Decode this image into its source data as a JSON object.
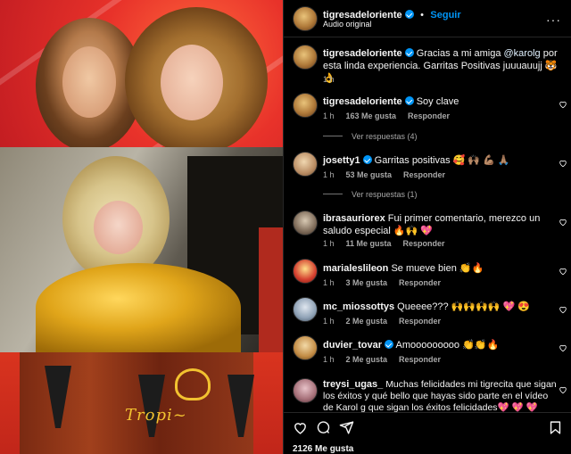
{
  "post": {
    "author": "tigresadeloriente",
    "follow_label": "Seguir",
    "separator": "•",
    "audio_label": "Audio original",
    "more": "···"
  },
  "caption": {
    "username": "tigresadeloriente",
    "text_before": "Gracias a mi amiga ",
    "mention": "@karolg",
    "text_after": " por esta linda experiencia. Garritas Positivas juuuauujj 🐯👌",
    "time": "1 h"
  },
  "comments": [
    {
      "username": "tigresadeloriente",
      "verified": true,
      "text": "Soy clave",
      "time": "1 h",
      "likes": "163 Me gusta",
      "reply": "Responder",
      "view_replies": "Ver respuestas (4)"
    },
    {
      "username": "josetty1",
      "verified": true,
      "text": "Garritas positivas 🥰 🙌🏽 💪🏽 🙏🏽",
      "time": "1 h",
      "likes": "53 Me gusta",
      "reply": "Responder",
      "view_replies": "Ver respuestas (1)"
    },
    {
      "username": "ibrasauriorex",
      "verified": false,
      "text": "Fui primer comentario, merezco un saludo especial 🔥🙌 💖",
      "time": "1 h",
      "likes": "11 Me gusta",
      "reply": "Responder"
    },
    {
      "username": "marialeslileon",
      "verified": false,
      "text": "Se mueve bien 👏🔥",
      "time": "1 h",
      "likes": "3 Me gusta",
      "reply": "Responder"
    },
    {
      "username": "mc_miossottys",
      "verified": false,
      "text": "Queeee??? 🙌🙌🙌🙌 💖 😍",
      "time": "1 h",
      "likes": "2 Me gusta",
      "reply": "Responder"
    },
    {
      "username": "duvier_tovar",
      "verified": true,
      "text": "Amooooooooo 👏👏🔥",
      "time": "1 h",
      "likes": "2 Me gusta",
      "reply": "Responder"
    },
    {
      "username": "treysi_ugas_",
      "verified": false,
      "text": "Muchas felicidades mi tigrecita que sigan los éxitos y qué bello que hayas sido parte en el vídeo de Karol g que sigan los éxitos felicidades💖 💖 💖",
      "time": "",
      "likes": "",
      "reply": ""
    }
  ],
  "footer": {
    "likes_total": "2126 Me gusta"
  },
  "media": {
    "logo_text": "Tropi[?]"
  },
  "colors": {
    "accent": "#0095f6",
    "background": "#000000",
    "muted": "#a8a8a8",
    "like_red": "#ff3040"
  }
}
